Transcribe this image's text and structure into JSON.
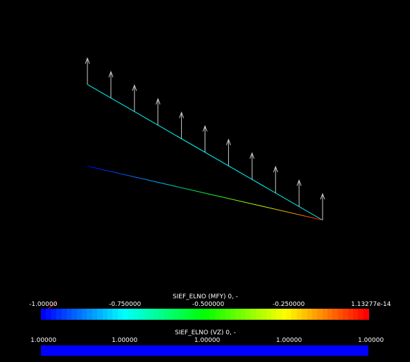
{
  "scalar_bar_1": {
    "title": "SIEF_ELNO (MFY) 0, -",
    "labels": [
      "-1.00000",
      "-0.750000",
      "-0.500000",
      "-0.250000",
      "1.13277e-14"
    ],
    "range": [
      -1.0,
      1.13277e-14
    ],
    "colormap": "rainbow blue-to-red"
  },
  "scalar_bar_2": {
    "title": "SIEF_ELNO (VZ) 0, -",
    "labels": [
      "1.00000",
      "1.00000",
      "1.00000",
      "1.00000",
      "1.00000"
    ],
    "range": [
      1.0,
      1.0
    ],
    "color": "#0000ff"
  },
  "scene": {
    "background": "#000000",
    "beam_color": "#00ffff",
    "arrow_color": "#cccccc",
    "arrow_count": 11
  }
}
